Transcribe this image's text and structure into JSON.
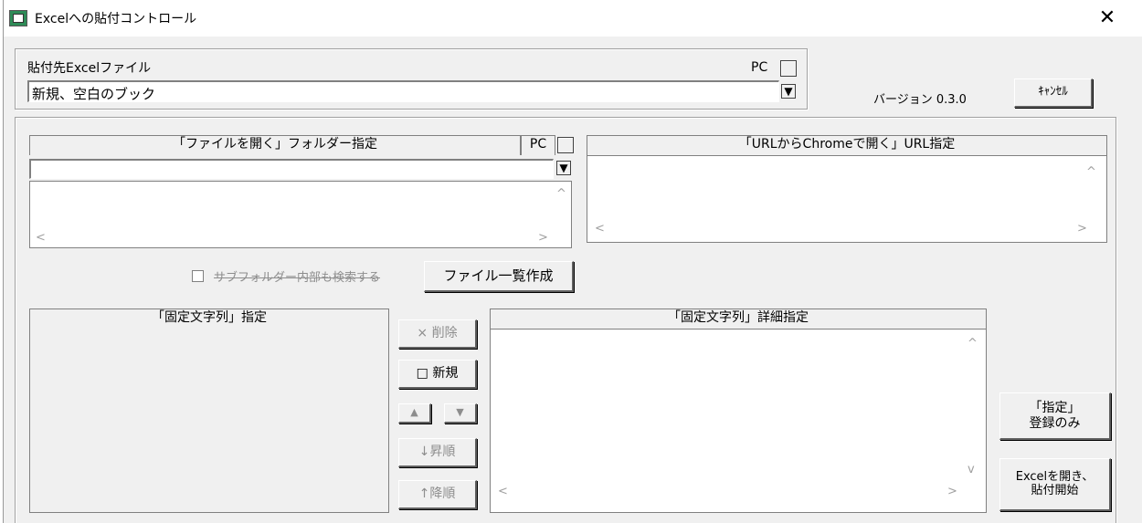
{
  "window": {
    "title": "Excelへの貼付コントロール",
    "close_glyph": "✕"
  },
  "paste_target": {
    "label": "貼付先Excelファイル",
    "pc_label": "PC",
    "selected": "新規、空白のブック",
    "dropdown_glyph": "▼"
  },
  "version": "バージョン 0.3.0",
  "cancel_label": "ｷｬﾝｾﾙ",
  "folder_panel": {
    "header": "「ファイルを開く」フォルダー指定",
    "pc_label": "PC",
    "value": "",
    "dropdown_glyph": "▼"
  },
  "url_panel": {
    "header": "「URLからChromeで開く」URL指定"
  },
  "subfolder_checkbox_label": "サブフォルダー内部も検索する",
  "file_list_button": "ファイル一覧作成",
  "fixed_string_panel": {
    "header": "「固定文字列」指定"
  },
  "fixed_detail_panel": {
    "header": "「固定文字列」詳細指定"
  },
  "middle_buttons": {
    "delete": "× 削除",
    "new": "□ 新規",
    "up": "▲",
    "down": "▼",
    "asc": "↓昇順",
    "desc": "↑降順"
  },
  "right_buttons": {
    "register_only_line1": "「指定」",
    "register_only_line2": "登録のみ",
    "open_paste_line1": "Excelを開き、",
    "open_paste_line2": "貼付開始"
  },
  "scroll_glyphs": {
    "left": "<",
    "right": ">",
    "up": "^",
    "down": "v"
  },
  "accent": {
    "title_bg": "#ffffff",
    "window_bg": "#f0f0f0"
  }
}
